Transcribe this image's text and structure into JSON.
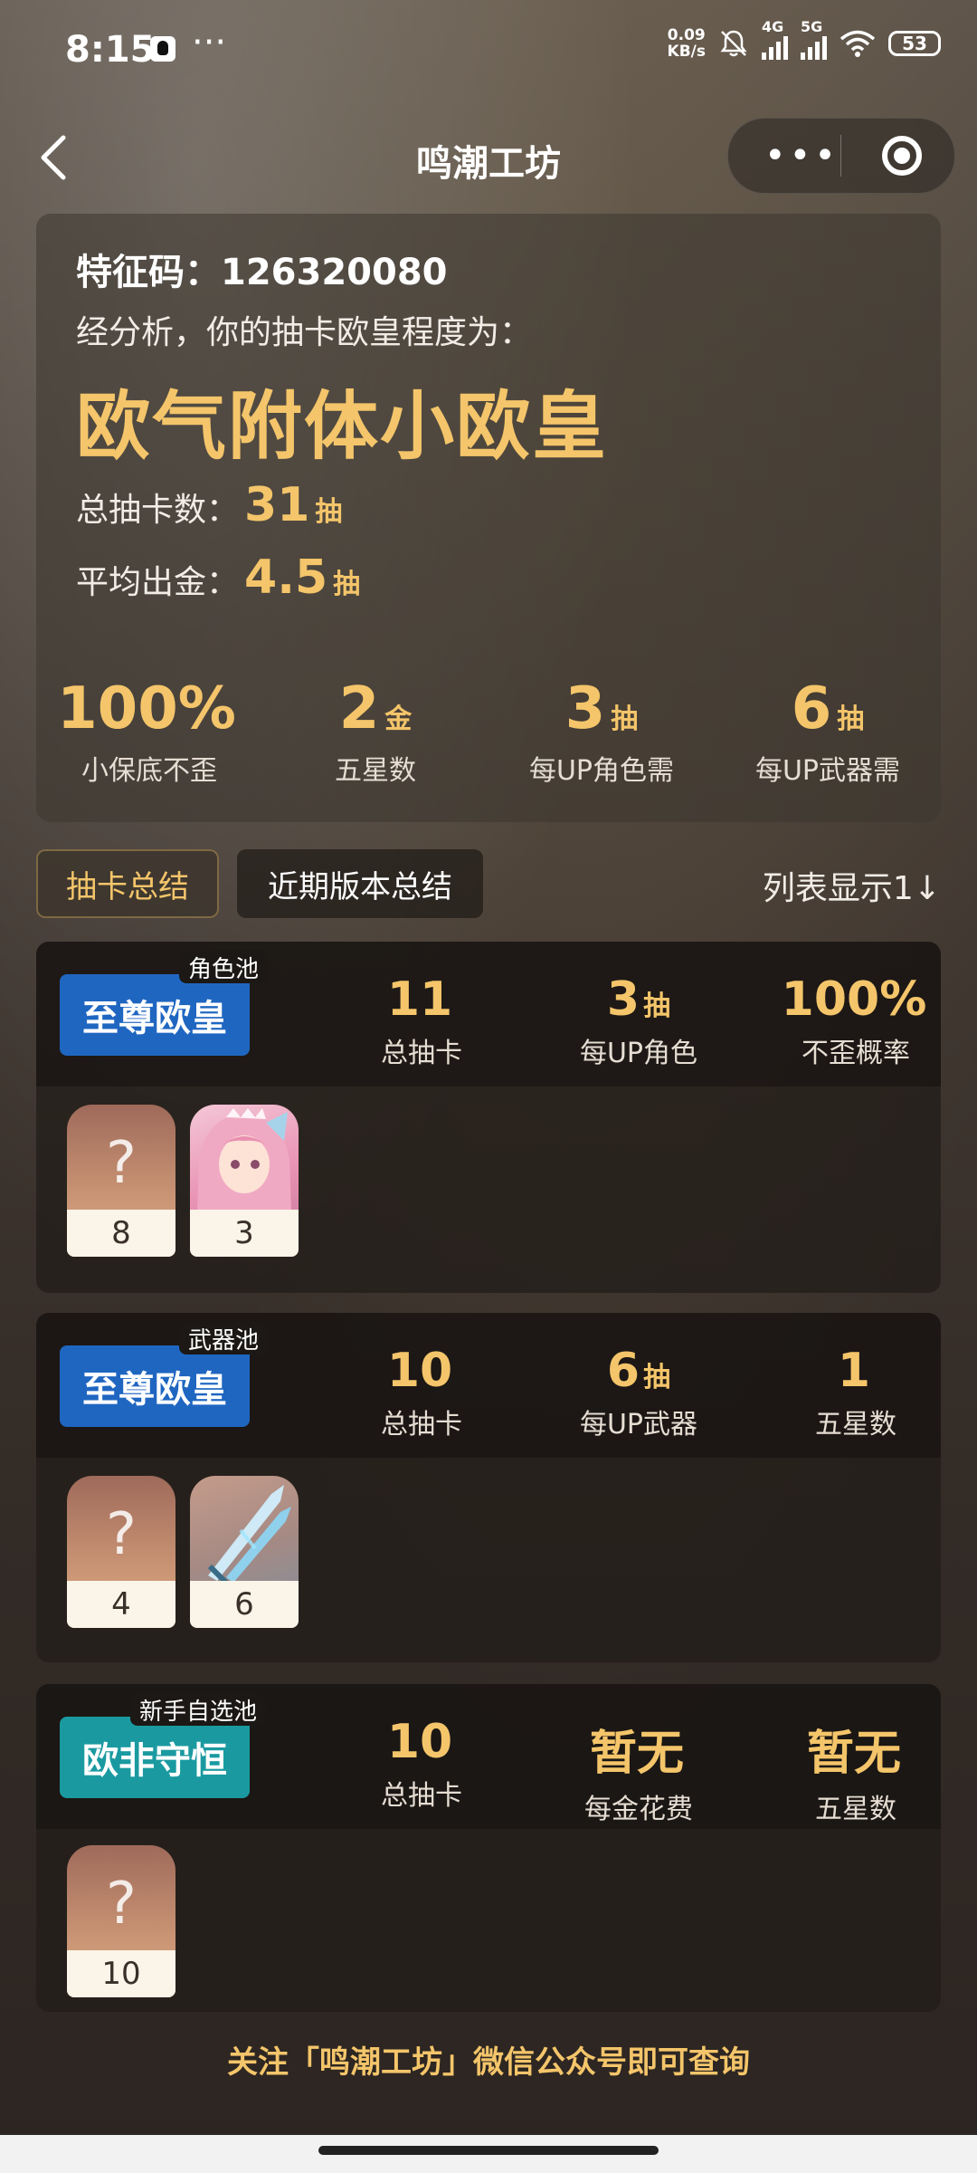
{
  "status_bar": {
    "time": "8:15",
    "dots": "···",
    "net_speed_value": "0.09",
    "net_speed_unit": "KB/s",
    "signal_1_label": "4G",
    "signal_2_label": "5G",
    "battery": "53"
  },
  "nav": {
    "title": "鸣潮工坊",
    "more_label": "•••"
  },
  "summary": {
    "feature_code_label": "特征码：",
    "feature_code": "126320080",
    "analysis_text": "经分析，你的抽卡欧皇程度为：",
    "rank_title": "欧气附体小欧皇",
    "total_pulls_label": "总抽卡数：",
    "total_pulls_value": "31",
    "total_pulls_unit": "抽",
    "avg_gold_label": "平均出金：",
    "avg_gold_value": "4.5",
    "avg_gold_unit": "抽",
    "stats": [
      {
        "value": "100%",
        "unit": "",
        "label": "小保底不歪"
      },
      {
        "value": "2",
        "unit": "金",
        "label": "五星数"
      },
      {
        "value": "3",
        "unit": "抽",
        "label": "每UP角色需"
      },
      {
        "value": "6",
        "unit": "抽",
        "label": "每UP武器需"
      }
    ]
  },
  "tabs": {
    "tab_1": "抽卡总结",
    "tab_2": "近期版本总结",
    "list_toggle": "列表显示1↓"
  },
  "pools": [
    {
      "type": "角色池",
      "badge": "至尊欧皇",
      "badge_color": "#1f66c1",
      "stats": [
        {
          "value": "11",
          "unit": "",
          "label": "总抽卡"
        },
        {
          "value": "3",
          "unit": "抽",
          "label": "每UP角色"
        },
        {
          "value": "100%",
          "unit": "",
          "label": "不歪概率"
        }
      ],
      "cards": [
        {
          "kind": "unknown",
          "mark": "?",
          "count": "8"
        },
        {
          "kind": "character",
          "mark": "",
          "count": "3"
        }
      ]
    },
    {
      "type": "武器池",
      "badge": "至尊欧皇",
      "badge_color": "#1f66c1",
      "stats": [
        {
          "value": "10",
          "unit": "",
          "label": "总抽卡"
        },
        {
          "value": "6",
          "unit": "抽",
          "label": "每UP武器"
        },
        {
          "value": "1",
          "unit": "",
          "label": "五星数"
        }
      ],
      "cards": [
        {
          "kind": "unknown",
          "mark": "?",
          "count": "4"
        },
        {
          "kind": "weapon",
          "mark": "",
          "count": "6"
        }
      ]
    },
    {
      "type": "新手自选池",
      "badge": "欧非守恒",
      "badge_color": "#1a9aa0",
      "stats": [
        {
          "value": "10",
          "unit": "",
          "label": "总抽卡"
        },
        {
          "value": "暂无",
          "unit": "",
          "label": "每金花费"
        },
        {
          "value": "暂无",
          "unit": "",
          "label": "五星数"
        }
      ],
      "cards": [
        {
          "kind": "unknown",
          "mark": "?",
          "count": "10"
        }
      ]
    }
  ],
  "footer_note": "关注「鸣潮工坊」微信公众号即可查询",
  "colors": {
    "accent_gold": "#f4c56a",
    "badge_blue": "#1f66c1",
    "badge_teal": "#1a9aa0"
  }
}
